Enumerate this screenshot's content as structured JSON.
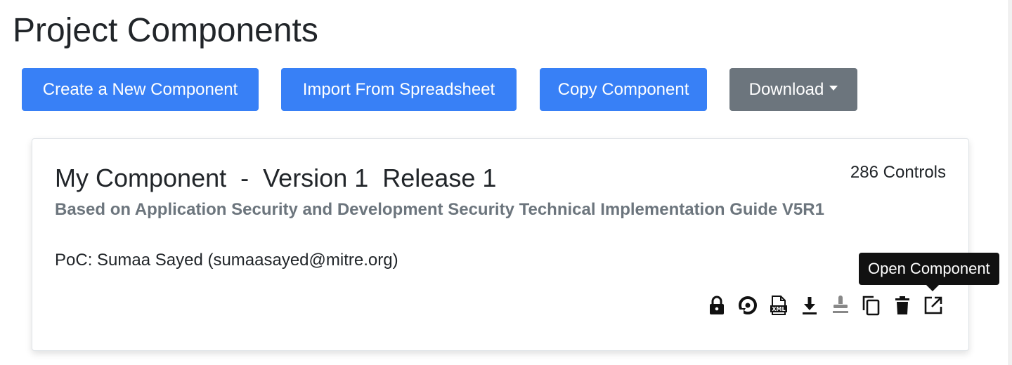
{
  "page": {
    "title": "Project Components"
  },
  "toolbar": {
    "create_label": "Create a New Component",
    "import_label": "Import From Spreadsheet",
    "copy_label": "Copy Component",
    "download_label": "Download"
  },
  "component_card": {
    "name": "My Component",
    "separator": "-",
    "version": "Version 1",
    "release": "Release 1",
    "controls_count": "286 Controls",
    "based_on": "Based on Application Security and Development Security Technical Implementation Guide V5R1",
    "poc": "PoC: Sumaa Sayed (sumaasayed@mitre.org)",
    "actions": [
      {
        "icon": "lock-icon"
      },
      {
        "icon": "history-icon"
      },
      {
        "icon": "xml-export-icon"
      },
      {
        "icon": "download-icon"
      },
      {
        "icon": "stamp-icon"
      },
      {
        "icon": "copy-icon"
      },
      {
        "icon": "trash-icon"
      },
      {
        "icon": "open-external-icon"
      }
    ]
  },
  "tooltip": {
    "text": "Open Component"
  },
  "colors": {
    "primary": "#3880f6",
    "secondary": "#6c757d",
    "muted_text": "#6c757d",
    "tooltip_bg": "#111111"
  }
}
